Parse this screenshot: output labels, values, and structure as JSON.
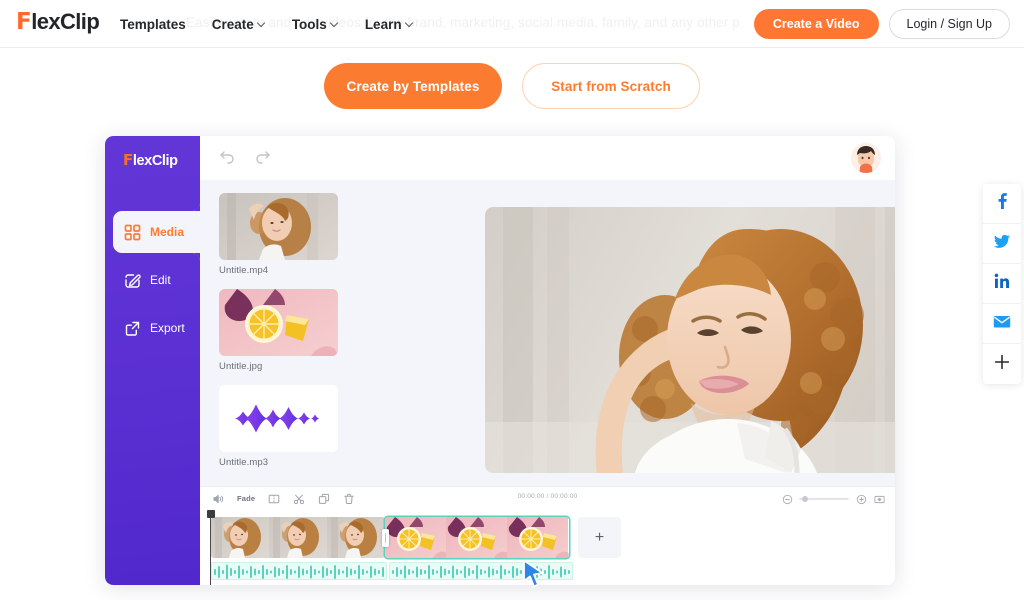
{
  "topnav": {
    "logo": {
      "accent": "F",
      "rest": "lexClip"
    },
    "ghost_tagline": "Easily create and edit videos for the brand, marketing, social media, family, and any other p",
    "links": [
      {
        "label": "Templates",
        "has_caret": false
      },
      {
        "label": "Create",
        "has_caret": true
      },
      {
        "label": "Tools",
        "has_caret": true
      },
      {
        "label": "Learn",
        "has_caret": true
      }
    ],
    "create_video_label": "Create a Video",
    "login_label": "Login / Sign Up"
  },
  "cta": {
    "primary_label": "Create by Templates",
    "secondary_label": "Start from Scratch"
  },
  "editor": {
    "sidebar": {
      "logo": {
        "accent": "F",
        "rest": "lexClip"
      },
      "items": [
        {
          "label": "Media",
          "icon": "grid-icon",
          "active": true
        },
        {
          "label": "Edit",
          "icon": "pencil-square-icon",
          "active": false
        },
        {
          "label": "Export",
          "icon": "export-arrow-icon",
          "active": false
        }
      ]
    },
    "topbar": {
      "undo_icon": "undo-icon",
      "redo_icon": "redo-icon",
      "avatar_icon": "user-avatar"
    },
    "media": [
      {
        "label": "Untitle.mp4",
        "type": "video"
      },
      {
        "label": "Untitle.jpg",
        "type": "image"
      },
      {
        "label": "Untitle.mp3",
        "type": "audio"
      }
    ],
    "timeline": {
      "tools": [
        {
          "name": "volume-icon",
          "label": ""
        },
        {
          "name": "fade-label",
          "label": "Fade"
        },
        {
          "name": "split-icon",
          "label": ""
        },
        {
          "name": "scissors-icon",
          "label": ""
        },
        {
          "name": "duplicate-icon",
          "label": ""
        },
        {
          "name": "trash-icon",
          "label": ""
        }
      ],
      "timecode": "00:00:00 / 00:00:00",
      "zoom_out_icon": "zoom-out-icon",
      "zoom_in_icon": "zoom-in-icon",
      "fit_icon": "fit-to-screen-icon",
      "zoom_value": 8,
      "add_clip_label": "+",
      "clips": [
        {
          "name": "video-clip-1",
          "type": "video"
        },
        {
          "name": "video-clip-2",
          "type": "image"
        }
      ],
      "audio_clips": [
        {
          "name": "audio-clip-1"
        },
        {
          "name": "audio-clip-2"
        }
      ]
    }
  },
  "share_rail": [
    {
      "name": "facebook-icon",
      "color": "#1877f2"
    },
    {
      "name": "twitter-icon",
      "color": "#1da1f2"
    },
    {
      "name": "linkedin-icon",
      "color": "#0a66c2"
    },
    {
      "name": "email-icon",
      "color": "#1d9bf0"
    },
    {
      "name": "more-share-icon",
      "color": "#2b2b2b"
    }
  ],
  "colors": {
    "brand_orange": "#ff7733",
    "cta_orange": "#fb7c31",
    "sidebar_purple": "#5a2fd2",
    "audio_green": "#5bd1c0",
    "panel_bg": "#f4f5fa"
  }
}
